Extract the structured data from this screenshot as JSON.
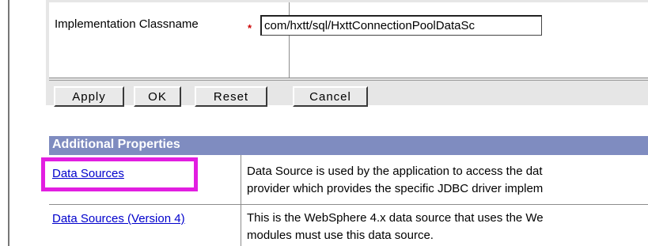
{
  "form": {
    "field_label": "Implementation Classname",
    "required_marker": "*",
    "field_value": "com/hxtt/sql/HxttConnectionPoolDataSc"
  },
  "buttons": {
    "apply": "Apply",
    "ok": "OK",
    "reset": "Reset",
    "cancel": "Cancel"
  },
  "additional_properties": {
    "header": "Additional Properties",
    "rows": [
      {
        "name": "Data Sources",
        "description_lines": [
          "Data Source is used by the application to access the dat",
          "provider which provides the specific JDBC driver implem"
        ]
      },
      {
        "name": "Data Sources (Version 4)",
        "description_lines": [
          "This is the WebSphere 4.x data source that uses the We",
          "modules must use this data source."
        ]
      }
    ]
  },
  "colors": {
    "header_bg": "#7f8cc0",
    "link": "#0000cc",
    "required": "#cc0000",
    "highlight": "#e21ee1"
  }
}
